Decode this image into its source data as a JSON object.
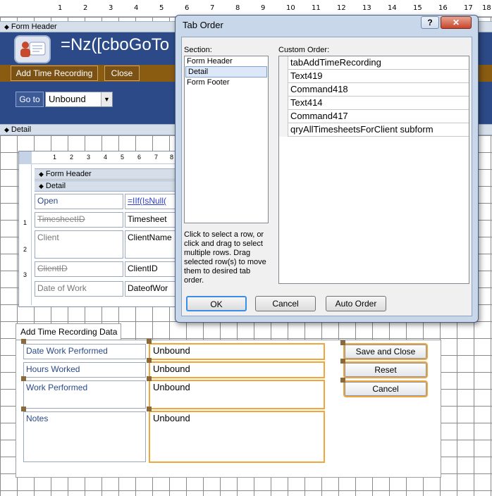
{
  "ruler": {
    "ticks": [
      "1",
      "2",
      "3",
      "4",
      "5",
      "6",
      "7",
      "8",
      "9",
      "10",
      "11",
      "12",
      "13",
      "14",
      "15",
      "16",
      "17",
      "18"
    ]
  },
  "form_header": {
    "band_label": "Form Header",
    "title_expr": "=Nz([cboGoTo",
    "add_button": "Add Time Recording",
    "close_button": "Close",
    "goto_label": "Go to",
    "goto_value": "Unbound"
  },
  "detail_band": "Detail",
  "subform": {
    "ruler_ticks": [
      "1",
      "2",
      "3",
      "4",
      "5",
      "6",
      "7",
      "8"
    ],
    "side_ticks": [
      "1",
      "2",
      "3"
    ],
    "header_band": "Form Header",
    "detail_band": "Detail",
    "rows": [
      {
        "label": "Open",
        "value": "=IIf(IsNull(",
        "strike": false
      },
      {
        "label": "TimesheetID",
        "value": "Timesheet",
        "strike": true
      },
      {
        "label": "Client",
        "value": "ClientName",
        "strike": false
      },
      {
        "label": "ClientID",
        "value": "ClientID",
        "strike": true
      },
      {
        "label": "Date of Work",
        "value": "DateofWor",
        "strike": true
      }
    ]
  },
  "tab_control": {
    "tab_label": "Add Time Recording Data",
    "fields": [
      {
        "label": "Date Work Performed",
        "value": "Unbound"
      },
      {
        "label": "Hours Worked",
        "value": "Unbound"
      },
      {
        "label": "Work Performed",
        "value": "Unbound"
      },
      {
        "label": "Notes",
        "value": "Unbound"
      }
    ],
    "buttons": {
      "save": "Save and Close",
      "reset": "Reset",
      "cancel": "Cancel"
    }
  },
  "dialog": {
    "title": "Tab Order",
    "help_glyph": "?",
    "close_glyph": "✕",
    "section_label": "Section:",
    "sections": [
      "Form Header",
      "Detail",
      "Form Footer"
    ],
    "selected_section": "Detail",
    "custom_order_label": "Custom Order:",
    "order_items": [
      "tabAddTimeRecording",
      "Text419",
      "Command418",
      "Text414",
      "Command417",
      "qryAllTimesheetsForClient subform"
    ],
    "instructions": "Click to select a row, or click and drag to select multiple rows.  Drag selected row(s) to move them to desired tab order.",
    "ok": "OK",
    "cancel": "Cancel",
    "auto_order": "Auto Order"
  },
  "colors": {
    "accent": "#2c4a87",
    "selection_orange": "#f2a53a",
    "toolbar_brown": "#8a5c12"
  }
}
